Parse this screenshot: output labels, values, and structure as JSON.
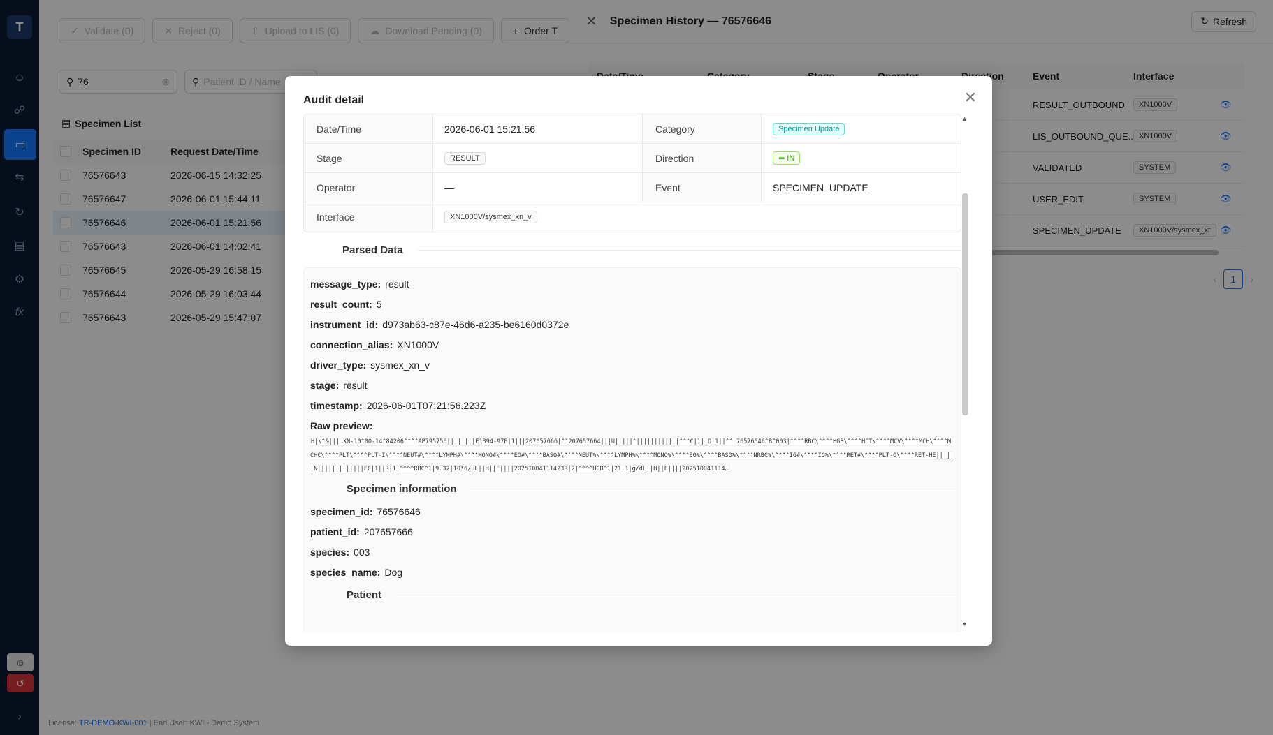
{
  "app": {
    "logo": "T"
  },
  "toolbar": {
    "validate": "Validate (0)",
    "reject": "Reject (0)",
    "upload": "Upload to LIS (0)",
    "download": "Download Pending (0)",
    "order": "Order T"
  },
  "filters": {
    "search_value": "76",
    "patient_placeholder": "Patient ID / Name"
  },
  "specimen_list": {
    "title": "Specimen List",
    "columns": [
      "Specimen ID",
      "Request Date/Time"
    ],
    "rows": [
      {
        "id": "76576643",
        "dt": "2026-06-15 14:32:25"
      },
      {
        "id": "76576647",
        "dt": "2026-06-01 15:44:11"
      },
      {
        "id": "76576646",
        "dt": "2026-06-01 15:21:56"
      },
      {
        "id": "76576643",
        "dt": "2026-06-01 14:02:41"
      },
      {
        "id": "76576645",
        "dt": "2026-05-29 16:58:15"
      },
      {
        "id": "76576644",
        "dt": "2026-05-29 16:03:44"
      },
      {
        "id": "76576643",
        "dt": "2026-05-29 15:47:07"
      }
    ]
  },
  "footer": {
    "prefix": "License:",
    "license": "TR-DEMO-KWI-001",
    "rest": "| End User: KWI - Demo System"
  },
  "drawer": {
    "title": "Specimen History — 76576646",
    "refresh": "Refresh",
    "columns": [
      "Date/Time",
      "Category",
      "Stage",
      "Operator",
      "Direction",
      "Event",
      "Interface"
    ],
    "rows": [
      {
        "event": "RESULT_OUTBOUND",
        "interface": "XN1000V"
      },
      {
        "event": "LIS_OUTBOUND_QUE...",
        "interface": "XN1000V"
      },
      {
        "event": "VALIDATED",
        "interface": "SYSTEM"
      },
      {
        "event": "USER_EDIT",
        "interface": "SYSTEM"
      },
      {
        "event": "SPECIMEN_UPDATE",
        "interface": "XN1000V/sysmex_xr"
      }
    ],
    "page": "1"
  },
  "modal": {
    "title": "Audit detail",
    "fields": {
      "datetime_label": "Date/Time",
      "datetime": "2026-06-01 15:21:56",
      "category_label": "Category",
      "category": "Specimen Update",
      "stage_label": "Stage",
      "stage": "RESULT",
      "direction_label": "Direction",
      "direction": "IN",
      "operator_label": "Operator",
      "operator": "—",
      "event_label": "Event",
      "event": "SPECIMEN_UPDATE",
      "interface_label": "Interface",
      "interface": "XN1000V/sysmex_xn_v"
    },
    "parsed_title": "Parsed Data",
    "parsed": [
      {
        "k": "message_type:",
        "v": "result"
      },
      {
        "k": "result_count:",
        "v": "5"
      },
      {
        "k": "instrument_id:",
        "v": "d973ab63-c87e-46d6-a235-be6160d0372e"
      },
      {
        "k": "connection_alias:",
        "v": "XN1000V"
      },
      {
        "k": "driver_type:",
        "v": "sysmex_xn_v"
      },
      {
        "k": "stage:",
        "v": "result"
      },
      {
        "k": "timestamp:",
        "v": "2026-06-01T07:21:56.223Z"
      }
    ],
    "raw_label": "Raw preview:",
    "raw": "H|\\^&|||    XN-10^00-14^84206^^^^AP795756||||||||E1394-97P|1|||207657666|^^207657664|||U|||||^||||||||||||^^^C|1||O|1||^^                76576646^B^003|^^^^RBC\\^^^^HGB\\^^^^HCT\\^^^^MCV\\^^^^MCH\\^^^^MCHC\\^^^^PLT\\^^^^PLT-I\\^^^^NEUT#\\^^^^LYMPH#\\^^^^MONO#\\^^^^EO#\\^^^^BASO#\\^^^^NEUT%\\^^^^LYMPH%\\^^^^MONO%\\^^^^EO%\\^^^^BASO%\\^^^^NRBC%\\^^^^IG#\\^^^^IG%\\^^^^RET#\\^^^^PLT-O\\^^^^RET-HE||||||N|||||||||||||FC|1||R|1|^^^^RBC^1|9.32|10*6/uL||H||F||||20251004111423R|2|^^^^HGB^1|21.1|g/dL||H||F||||202510041114…",
    "specimen_title": "Specimen information",
    "specimen": [
      {
        "k": "specimen_id:",
        "v": "76576646"
      },
      {
        "k": "patient_id:",
        "v": "207657666"
      },
      {
        "k": "species:",
        "v": "003"
      },
      {
        "k": "species_name:",
        "v": "Dog"
      }
    ],
    "patient_title": "Patient"
  }
}
